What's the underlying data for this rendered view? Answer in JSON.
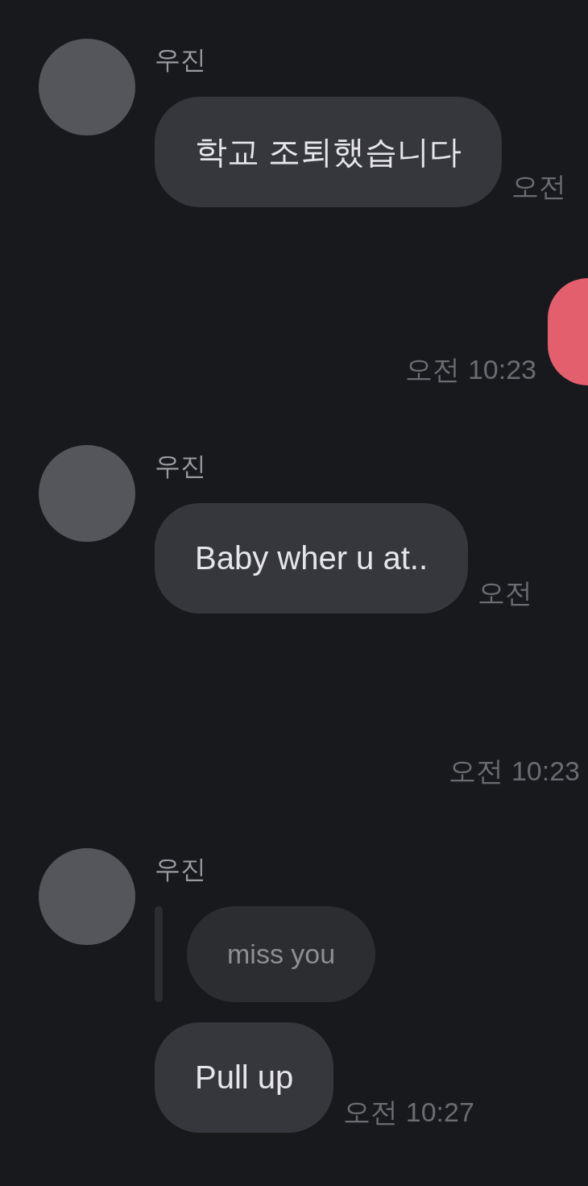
{
  "conversation": [
    {
      "kind": "incoming",
      "sender": "우진",
      "messages": [
        {
          "kind": "text",
          "text": "학교 조퇴했습니다",
          "time": "오전"
        }
      ]
    },
    {
      "kind": "outgoing",
      "time": "오전 10:23"
    },
    {
      "kind": "incoming",
      "sender": "우진",
      "messages": [
        {
          "kind": "text",
          "text": "Baby wher u at..",
          "time": "오전"
        }
      ]
    },
    {
      "kind": "time_only",
      "time": "오전 10:23"
    },
    {
      "kind": "incoming",
      "sender": "우진",
      "messages": [
        {
          "kind": "reply",
          "text": "miss you"
        },
        {
          "kind": "text",
          "text": "Pull up",
          "time": "오전 10:27"
        }
      ]
    }
  ]
}
